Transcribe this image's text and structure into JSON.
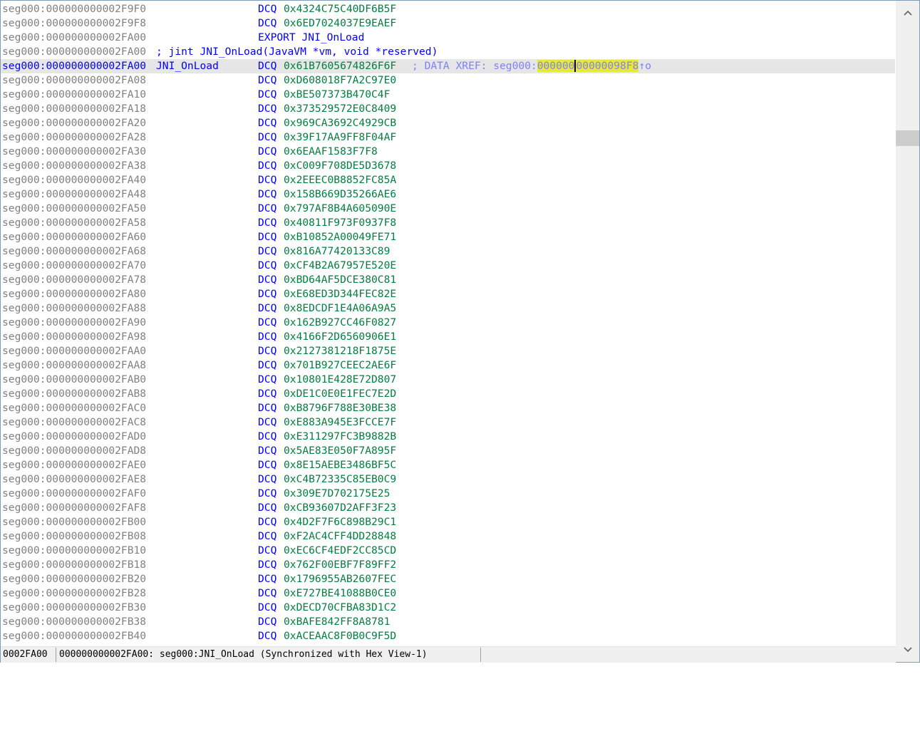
{
  "lines": [
    {
      "kind": "data",
      "addr": "seg000:000000000002F9F0",
      "label": "",
      "mnem": "DCQ",
      "oper": "0x4324C75C40DF6B5F"
    },
    {
      "kind": "data",
      "addr": "seg000:000000000002F9F8",
      "label": "",
      "mnem": "DCQ",
      "oper": "0x6ED7024037E9EAEF"
    },
    {
      "kind": "export",
      "addr": "seg000:000000000002FA00",
      "text": "EXPORT JNI_OnLoad"
    },
    {
      "kind": "comment",
      "addr": "seg000:000000000002FA00",
      "text": "; jint JNI_OnLoad(JavaVM *vm, void *reserved)"
    },
    {
      "kind": "data",
      "current": true,
      "addr": "seg000:000000000002FA00",
      "label": "JNI_OnLoad",
      "mnem": "DCQ",
      "oper": "0x61B7605674826F6F",
      "xref_prefix": "; DATA XREF: seg000:",
      "xref_hl_a": "000000",
      "xref_hl_b": "00000098F8",
      "xref_suffix": "↑o"
    },
    {
      "kind": "data",
      "addr": "seg000:000000000002FA08",
      "label": "",
      "mnem": "DCQ",
      "oper": "0xD608018F7A2C97E0"
    },
    {
      "kind": "data",
      "addr": "seg000:000000000002FA10",
      "label": "",
      "mnem": "DCQ",
      "oper": "0xBE507373B470C4F"
    },
    {
      "kind": "data",
      "addr": "seg000:000000000002FA18",
      "label": "",
      "mnem": "DCQ",
      "oper": "0x373529572E0C8409"
    },
    {
      "kind": "data",
      "addr": "seg000:000000000002FA20",
      "label": "",
      "mnem": "DCQ",
      "oper": "0x969CA3692C4929CB"
    },
    {
      "kind": "data",
      "addr": "seg000:000000000002FA28",
      "label": "",
      "mnem": "DCQ",
      "oper": "0x39F17AA9FF8F04AF"
    },
    {
      "kind": "data",
      "addr": "seg000:000000000002FA30",
      "label": "",
      "mnem": "DCQ",
      "oper": "0x6EAAF1583F7F8"
    },
    {
      "kind": "data",
      "addr": "seg000:000000000002FA38",
      "label": "",
      "mnem": "DCQ",
      "oper": "0xC009F708DE5D3678"
    },
    {
      "kind": "data",
      "addr": "seg000:000000000002FA40",
      "label": "",
      "mnem": "DCQ",
      "oper": "0x2EEEC0B8852FC85A"
    },
    {
      "kind": "data",
      "addr": "seg000:000000000002FA48",
      "label": "",
      "mnem": "DCQ",
      "oper": "0x158B669D35266AE6"
    },
    {
      "kind": "data",
      "addr": "seg000:000000000002FA50",
      "label": "",
      "mnem": "DCQ",
      "oper": "0x797AF8B4A605090E"
    },
    {
      "kind": "data",
      "addr": "seg000:000000000002FA58",
      "label": "",
      "mnem": "DCQ",
      "oper": "0x40811F973F0937F8"
    },
    {
      "kind": "data",
      "addr": "seg000:000000000002FA60",
      "label": "",
      "mnem": "DCQ",
      "oper": "0xB10852A00049FE71"
    },
    {
      "kind": "data",
      "addr": "seg000:000000000002FA68",
      "label": "",
      "mnem": "DCQ",
      "oper": "0x816A77420133C89"
    },
    {
      "kind": "data",
      "addr": "seg000:000000000002FA70",
      "label": "",
      "mnem": "DCQ",
      "oper": "0xCF4B2A67957E520E"
    },
    {
      "kind": "data",
      "addr": "seg000:000000000002FA78",
      "label": "",
      "mnem": "DCQ",
      "oper": "0xBD64AF5DCE380C81"
    },
    {
      "kind": "data",
      "addr": "seg000:000000000002FA80",
      "label": "",
      "mnem": "DCQ",
      "oper": "0xE68ED3D344FEC82E"
    },
    {
      "kind": "data",
      "addr": "seg000:000000000002FA88",
      "label": "",
      "mnem": "DCQ",
      "oper": "0x8EDCDF1E4A06A9A5"
    },
    {
      "kind": "data",
      "addr": "seg000:000000000002FA90",
      "label": "",
      "mnem": "DCQ",
      "oper": "0x162B927CC46F0827"
    },
    {
      "kind": "data",
      "addr": "seg000:000000000002FA98",
      "label": "",
      "mnem": "DCQ",
      "oper": "0x4166F2D6560906E1"
    },
    {
      "kind": "data",
      "addr": "seg000:000000000002FAA0",
      "label": "",
      "mnem": "DCQ",
      "oper": "0x2127381218F1875E"
    },
    {
      "kind": "data",
      "addr": "seg000:000000000002FAA8",
      "label": "",
      "mnem": "DCQ",
      "oper": "0x701B927CEEC2AE6F"
    },
    {
      "kind": "data",
      "addr": "seg000:000000000002FAB0",
      "label": "",
      "mnem": "DCQ",
      "oper": "0x10801E428E72D807"
    },
    {
      "kind": "data",
      "addr": "seg000:000000000002FAB8",
      "label": "",
      "mnem": "DCQ",
      "oper": "0xDE1C0E0E1FEC7E2D"
    },
    {
      "kind": "data",
      "addr": "seg000:000000000002FAC0",
      "label": "",
      "mnem": "DCQ",
      "oper": "0xB8796F788E30BE38"
    },
    {
      "kind": "data",
      "addr": "seg000:000000000002FAC8",
      "label": "",
      "mnem": "DCQ",
      "oper": "0xE883A945E3FCCE7F"
    },
    {
      "kind": "data",
      "addr": "seg000:000000000002FAD0",
      "label": "",
      "mnem": "DCQ",
      "oper": "0xE311297FC3B9882B"
    },
    {
      "kind": "data",
      "addr": "seg000:000000000002FAD8",
      "label": "",
      "mnem": "DCQ",
      "oper": "0x5AE83E050F7A895F"
    },
    {
      "kind": "data",
      "addr": "seg000:000000000002FAE0",
      "label": "",
      "mnem": "DCQ",
      "oper": "0x8E15AEBE3486BF5C"
    },
    {
      "kind": "data",
      "addr": "seg000:000000000002FAE8",
      "label": "",
      "mnem": "DCQ",
      "oper": "0xC4B72335C85EB0C9"
    },
    {
      "kind": "data",
      "addr": "seg000:000000000002FAF0",
      "label": "",
      "mnem": "DCQ",
      "oper": "0x309E7D702175E25"
    },
    {
      "kind": "data",
      "addr": "seg000:000000000002FAF8",
      "label": "",
      "mnem": "DCQ",
      "oper": "0xCB93607D2AFF3F23"
    },
    {
      "kind": "data",
      "addr": "seg000:000000000002FB00",
      "label": "",
      "mnem": "DCQ",
      "oper": "0x4D2F7F6C898B29C1"
    },
    {
      "kind": "data",
      "addr": "seg000:000000000002FB08",
      "label": "",
      "mnem": "DCQ",
      "oper": "0xF2AC4CFF4DD28848"
    },
    {
      "kind": "data",
      "addr": "seg000:000000000002FB10",
      "label": "",
      "mnem": "DCQ",
      "oper": "0xEC6CF4EDF2CC85CD"
    },
    {
      "kind": "data",
      "addr": "seg000:000000000002FB18",
      "label": "",
      "mnem": "DCQ",
      "oper": "0x762F00EBF7F89FF2"
    },
    {
      "kind": "data",
      "addr": "seg000:000000000002FB20",
      "label": "",
      "mnem": "DCQ",
      "oper": "0x1796955AB2607FEC"
    },
    {
      "kind": "data",
      "addr": "seg000:000000000002FB28",
      "label": "",
      "mnem": "DCQ",
      "oper": "0xE727BE41088B0CE0"
    },
    {
      "kind": "data",
      "addr": "seg000:000000000002FB30",
      "label": "",
      "mnem": "DCQ",
      "oper": "0xDECD70CFBA83D1C2"
    },
    {
      "kind": "data",
      "addr": "seg000:000000000002FB38",
      "label": "",
      "mnem": "DCQ",
      "oper": "0xBAFE842FF8A8781"
    },
    {
      "kind": "data",
      "addr": "seg000:000000000002FB40",
      "label": "",
      "mnem": "DCQ",
      "oper": "0xACEAAC8F0B0C9F5D"
    }
  ],
  "statusbar": {
    "offset": "0002FA00",
    "message": "000000000002FA00: seg000:JNI_OnLoad (Synchronized with Hex View-1)"
  },
  "scrollbar": {
    "up_icon": "▲",
    "down_icon": "▼"
  },
  "colors": {
    "address": "#808080",
    "current_address": "#0000ff",
    "mnemonic": "#0000ff",
    "operand": "#008040",
    "xref_comment": "#8080ff",
    "highlight": "#e8e838",
    "current_line_bg": "#e6e6e6"
  }
}
